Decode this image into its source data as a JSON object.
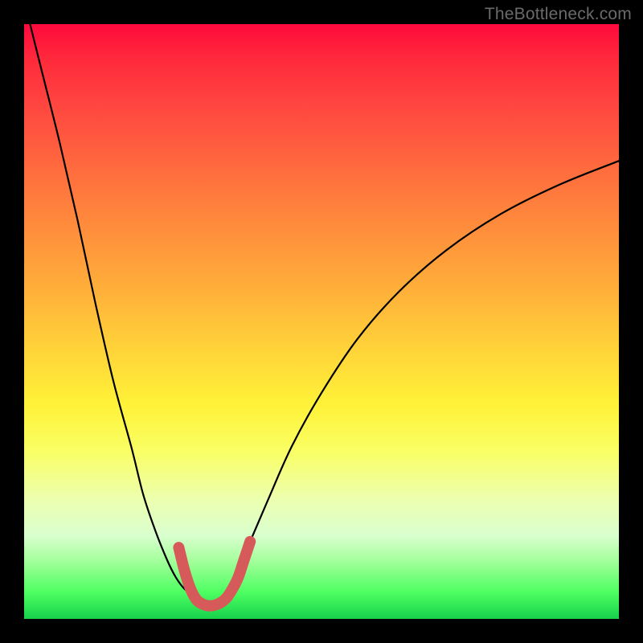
{
  "watermark": "TheBottleneck.com",
  "chart_data": {
    "type": "line",
    "title": "",
    "xlabel": "",
    "ylabel": "",
    "xlim": [
      0,
      100
    ],
    "ylim": [
      0,
      100
    ],
    "series": [
      {
        "name": "black-curve-left",
        "color": "#000000",
        "x": [
          1,
          3,
          6,
          9,
          12,
          15,
          18,
          20,
          22,
          24,
          25.5,
          27,
          28.5
        ],
        "y": [
          100,
          92,
          80,
          67,
          53,
          40,
          29,
          21,
          15,
          10,
          7,
          5,
          4
        ]
      },
      {
        "name": "black-curve-right",
        "color": "#000000",
        "x": [
          34,
          36,
          38,
          41,
          45,
          50,
          56,
          63,
          71,
          80,
          90,
          100
        ],
        "y": [
          4,
          8,
          13,
          20,
          29,
          38,
          47,
          55,
          62,
          68,
          73,
          77
        ]
      },
      {
        "name": "pink-trough",
        "color": "#d75a5a",
        "x": [
          26,
          27,
          28,
          29,
          30,
          31,
          32,
          33,
          34,
          35,
          36,
          37,
          38
        ],
        "y": [
          12,
          8,
          5,
          3.2,
          2.5,
          2.2,
          2.3,
          2.7,
          3.5,
          5,
          7,
          10,
          13
        ]
      }
    ],
    "background_gradient": {
      "top": "#ff0a3c",
      "mid": "#ffe638",
      "bottom": "#17d14b"
    }
  }
}
